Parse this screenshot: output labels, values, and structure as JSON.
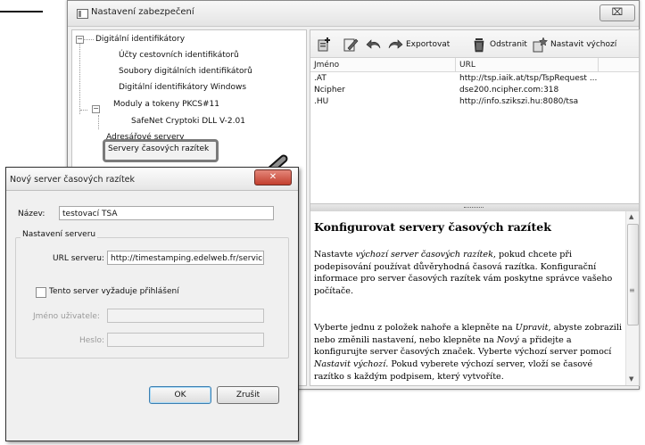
{
  "main_window": {
    "title": "Nastavení zabezpečení",
    "close_glyph": "⌧"
  },
  "tree": {
    "items": [
      {
        "label": "Digitální identifikátory",
        "toggle": "−"
      },
      {
        "label": "Účty cestovních identifikátorů"
      },
      {
        "label": "Soubory digitálních identifikátorů"
      },
      {
        "label": "Digitální identifikátory Windows"
      },
      {
        "label": "Moduly a tokeny PKCS#11",
        "toggle": "−"
      },
      {
        "label": "SafeNet Cryptoki DLL V-2.01"
      },
      {
        "label": "Adresářové servery"
      },
      {
        "label": "Servery časových razítek"
      }
    ]
  },
  "toolbar": {
    "export_label": "Exportovat",
    "delete_label": "Odstranit",
    "set_default_label": "Nastavit výchozí",
    "icons": [
      "new-server-icon",
      "edit-icon",
      "undo-icon",
      "export-icon",
      "delete-icon",
      "set-default-icon"
    ]
  },
  "list": {
    "columns": [
      "Jméno",
      "URL"
    ],
    "rows": [
      {
        "name": ".AT",
        "url": "http://tsp.iaik.at/tsp/TspRequest ..."
      },
      {
        "name": "Ncipher",
        "url": "dse200.ncipher.com:318"
      },
      {
        "name": ".HU",
        "url": "http://info.szikszi.hu:8080/tsa"
      }
    ]
  },
  "help": {
    "title": "Konfigurovat servery časových razítek",
    "p1_a": "Nastavte ",
    "p1_i": "výchozí server časových razítek",
    "p1_b": ", pokud chcete při podepisování používat důvěryhodná časová razítka. Konfigurační informace pro server časových razítek vám poskytne správce vašeho počítače.",
    "p2_a": "Vyberte jednu z položek nahoře a klepněte na ",
    "p2_i1": "Upravit",
    "p2_b": ", abyste zobrazili nebo změnili nastavení, nebo klepněte na ",
    "p2_i2": "Nový",
    "p2_c": " a přidejte a konfigurujte server časových značek. Vyberte výchozí server pomocí ",
    "p2_i3": "Nastavit výchozí",
    "p2_d": ". Pokud vyberete výchozí server, vloží se časové razítko s každým podpisem, který vytvoříte.",
    "scroll_up": "▲",
    "scroll_down": "▼",
    "scroll_grip": "≡"
  },
  "dialog": {
    "title": "Nový server časových razítek",
    "close_glyph": "✕",
    "name_label": "Název:",
    "name_value": "testovací TSA",
    "group_title": "Nastavení serveru",
    "url_label": "URL serveru:",
    "url_value": "http://timestamping.edelweb.fr/service/",
    "login_checkbox_label": "Tento server vyžaduje přihlášení",
    "login_checked": false,
    "username_label": "Jméno uživatele:",
    "username_value": "",
    "password_label": "Heslo:",
    "password_value": "",
    "ok_label": "OK",
    "cancel_label": "Zrušit"
  }
}
